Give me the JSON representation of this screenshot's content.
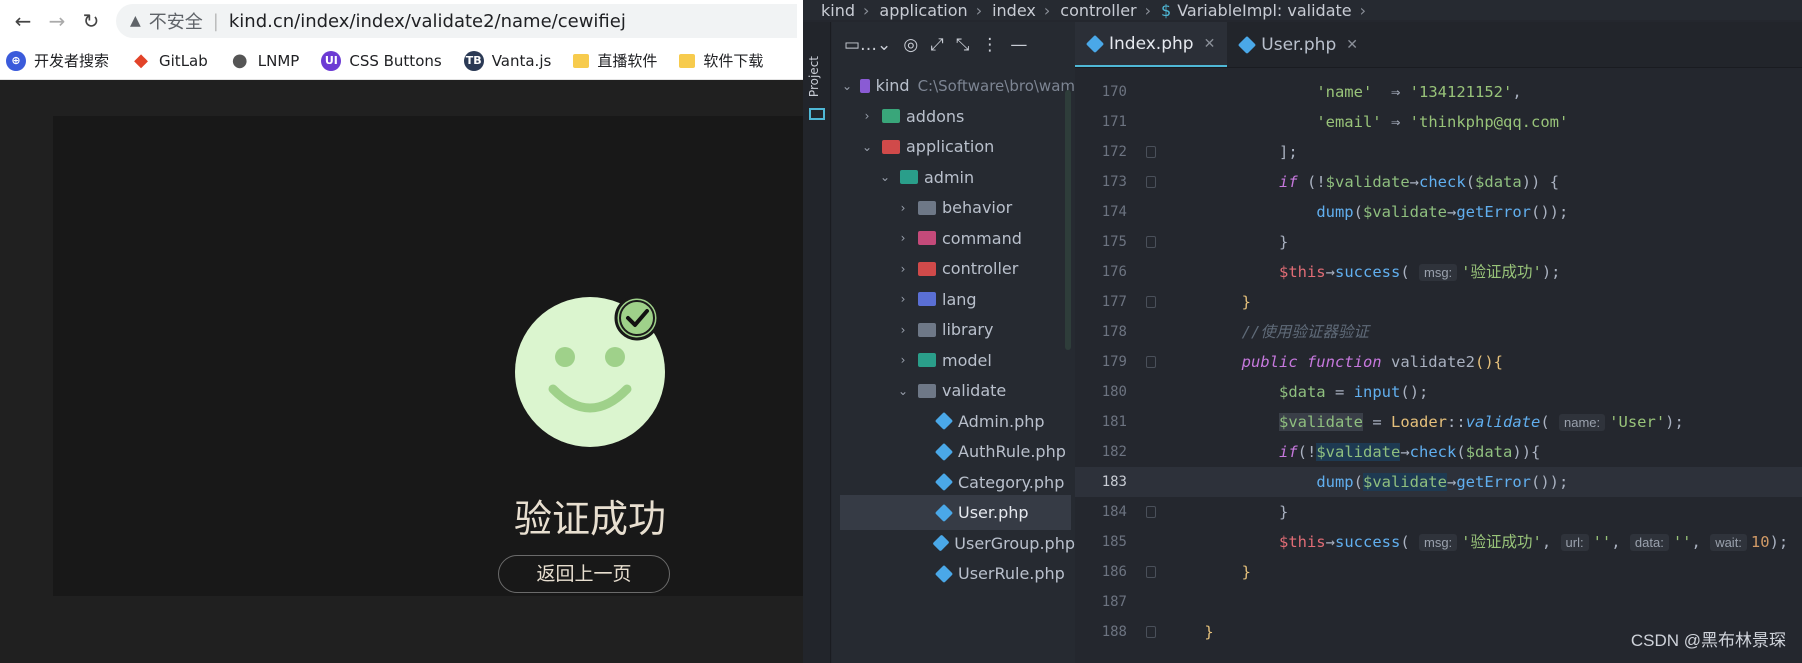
{
  "browser": {
    "insecure_label": "不安全",
    "url": "kind.cn/index/index/validate2/name/cewifiej",
    "bookmarks": [
      {
        "label": "开发者搜索",
        "icon": "search-dev-icon",
        "color": "#3b5bdb"
      },
      {
        "label": "GitLab",
        "icon": "gitlab-icon",
        "color": "#e24329"
      },
      {
        "label": "LNMP",
        "icon": "globe-icon",
        "color": "#555555"
      },
      {
        "label": "CSS Buttons",
        "icon": "ui-icon",
        "color": "#6c3bd4"
      },
      {
        "label": "Vanta.js",
        "icon": "tb-icon",
        "color": "#2b3a55"
      },
      {
        "label": "直播软件",
        "icon": "folder-icon",
        "color": "#f7cb4d"
      },
      {
        "label": "软件下载",
        "icon": "folder-icon",
        "color": "#f7cb4d"
      }
    ],
    "success_title": "验证成功",
    "back_button": "返回上一页"
  },
  "ide": {
    "breadcrumb": [
      "kind",
      "application",
      "index",
      "controller",
      "VariableImpl: validate"
    ],
    "project_label": "Project",
    "tree": [
      {
        "label": "kind",
        "path": "C:\\Software\\bro\\wam",
        "depth": 0,
        "open": true,
        "icon": "purple"
      },
      {
        "label": "addons",
        "depth": 1,
        "open": false,
        "icon": "green"
      },
      {
        "label": "application",
        "depth": 1,
        "open": true,
        "icon": "red"
      },
      {
        "label": "admin",
        "depth": 2,
        "open": true,
        "icon": "teal"
      },
      {
        "label": "behavior",
        "depth": 3,
        "open": false,
        "icon": "folder"
      },
      {
        "label": "command",
        "depth": 3,
        "open": false,
        "icon": "pink"
      },
      {
        "label": "controller",
        "depth": 3,
        "open": false,
        "icon": "red"
      },
      {
        "label": "lang",
        "depth": 3,
        "open": false,
        "icon": "blue"
      },
      {
        "label": "library",
        "depth": 3,
        "open": false,
        "icon": "folder"
      },
      {
        "label": "model",
        "depth": 3,
        "open": false,
        "icon": "teal"
      },
      {
        "label": "validate",
        "depth": 3,
        "open": true,
        "icon": "folder"
      },
      {
        "label": "Admin.php",
        "depth": 4,
        "file": true
      },
      {
        "label": "AuthRule.php",
        "depth": 4,
        "file": true
      },
      {
        "label": "Category.php",
        "depth": 4,
        "file": true
      },
      {
        "label": "User.php",
        "depth": 4,
        "file": true,
        "selected": true
      },
      {
        "label": "UserGroup.php",
        "depth": 4,
        "file": true
      },
      {
        "label": "UserRule.php",
        "depth": 4,
        "file": true
      }
    ],
    "tabs": [
      {
        "label": "Index.php",
        "active": true
      },
      {
        "label": "User.php",
        "active": false
      }
    ],
    "line_numbers": [
      "170",
      "171",
      "172",
      "173",
      "174",
      "175",
      "176",
      "177",
      "178",
      "179",
      "180",
      "181",
      "182",
      "183",
      "184",
      "185",
      "186",
      "187",
      "188"
    ],
    "current_line": "183"
  },
  "watermark": "CSDN @黑布林景琛"
}
